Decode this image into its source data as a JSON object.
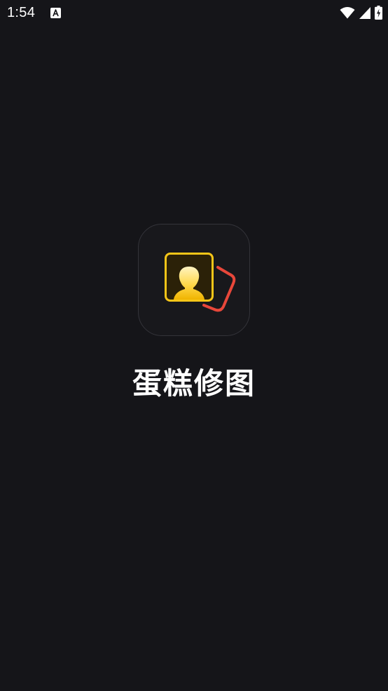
{
  "status_bar": {
    "time": "1:54",
    "notification_icon": "a-letter-icon",
    "right_icons": [
      "wifi-icon",
      "cellular-signal-icon",
      "battery-charging-icon"
    ]
  },
  "splash": {
    "app_name": "蛋糕修图",
    "logo_icon": "portrait-photo-icon",
    "colors": {
      "background": "#151519",
      "icon_tile": "#18181c",
      "frame_yellow": "#f5c518",
      "accent_red": "#e8473a"
    }
  }
}
